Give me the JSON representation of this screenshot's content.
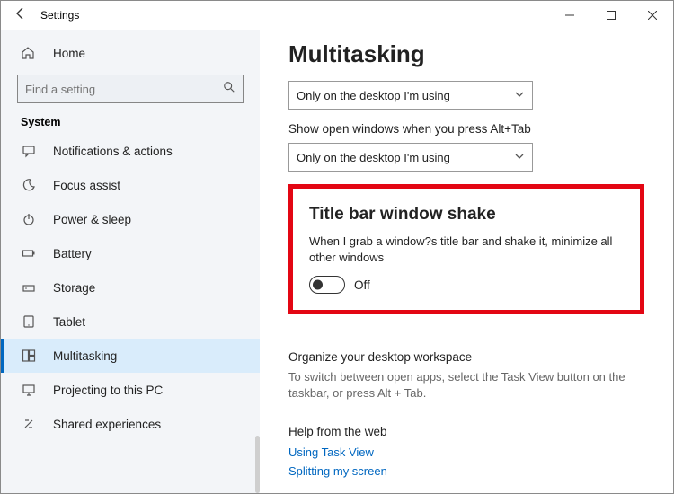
{
  "window": {
    "title": "Settings"
  },
  "sidebar": {
    "home_label": "Home",
    "search_placeholder": "Find a setting",
    "category_title": "System",
    "items": [
      {
        "label": "Notifications & actions"
      },
      {
        "label": "Focus assist"
      },
      {
        "label": "Power & sleep"
      },
      {
        "label": "Battery"
      },
      {
        "label": "Storage"
      },
      {
        "label": "Tablet"
      },
      {
        "label": "Multitasking"
      },
      {
        "label": "Projecting to this PC"
      },
      {
        "label": "Shared experiences"
      }
    ]
  },
  "main": {
    "page_title": "Multitasking",
    "dropdown1_value": "Only on the desktop I'm using",
    "alt_tab_label": "Show open windows when you press Alt+Tab",
    "dropdown2_value": "Only on the desktop I'm using",
    "shake": {
      "heading": "Title bar window shake",
      "description": "When I grab a window?s title bar and shake it, minimize all other windows",
      "state_label": "Off"
    },
    "workspace": {
      "heading": "Organize your desktop workspace",
      "body": "To switch between open apps, select the Task View button on the taskbar, or press Alt + Tab."
    },
    "help": {
      "heading": "Help from the web",
      "links": [
        "Using Task View",
        "Splitting my screen"
      ]
    }
  }
}
